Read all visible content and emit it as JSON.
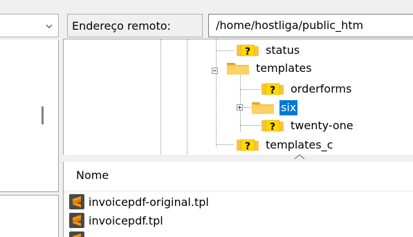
{
  "remote": {
    "address_label": "Endereço remoto:",
    "address_value": "/home/hostliga/public_htm",
    "tree": [
      {
        "label": "status",
        "icon": "unknown-folder-icon",
        "selected": false
      },
      {
        "label": "templates",
        "icon": "folder-icon",
        "selected": false,
        "expanded": true
      },
      {
        "label": "orderforms",
        "icon": "unknown-folder-icon",
        "selected": false
      },
      {
        "label": "six",
        "icon": "folder-icon",
        "selected": true,
        "expandable": true
      },
      {
        "label": "twenty-one",
        "icon": "unknown-folder-icon",
        "selected": false
      },
      {
        "label": "templates_c",
        "icon": "unknown-folder-icon",
        "selected": false
      }
    ],
    "file_list": {
      "column_name": "Nome",
      "files": [
        {
          "name": "invoicepdf-original.tpl",
          "icon": "sublime-file-icon"
        },
        {
          "name": "invoicepdf.tpl",
          "icon": "sublime-file-icon"
        }
      ]
    }
  },
  "colors": {
    "selection": "#0078d7",
    "folder": "#f7c244",
    "unknown_badge": "#ffd800",
    "sublime_bg": "#4a4a4a",
    "sublime_accent": "#ff9800"
  }
}
